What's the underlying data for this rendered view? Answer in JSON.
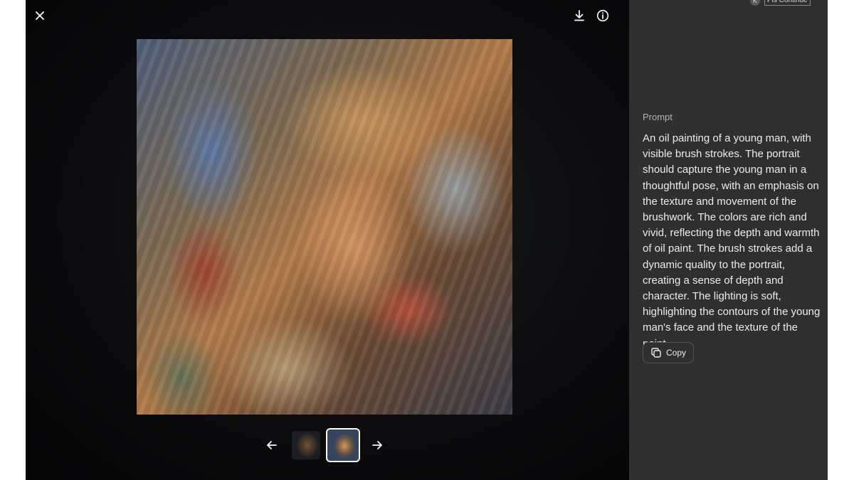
{
  "viewer": {
    "close_icon": "close-icon",
    "download_icon": "download-icon",
    "info_icon": "info-icon",
    "prev_icon": "arrow-left-icon",
    "next_icon": "arrow-right-icon",
    "thumbnails": [
      {
        "state": "inactive"
      },
      {
        "state": "selected"
      }
    ]
  },
  "user": {
    "avatar_initial": "K",
    "label": "Pls Continue"
  },
  "side_panel": {
    "prompt_label": "Prompt",
    "prompt_text": "An oil painting of a young man, with visible brush strokes. The portrait should capture the young man in a thoughtful pose, with an emphasis on the texture and movement of the brushwork. The colors are rich and vivid, reflecting the depth and warmth of oil paint. The brush strokes add a dynamic quality to the portrait, creating a sense of depth and character. The lighting is soft, highlighting the contours of the young man's face and the texture of the paint.",
    "copy_label": "Copy"
  },
  "colors": {
    "viewer_bg": "#0c0c0e",
    "panel_bg": "#2f2f2f",
    "panel_text": "#ececec",
    "panel_muted": "#b4b4b4"
  }
}
